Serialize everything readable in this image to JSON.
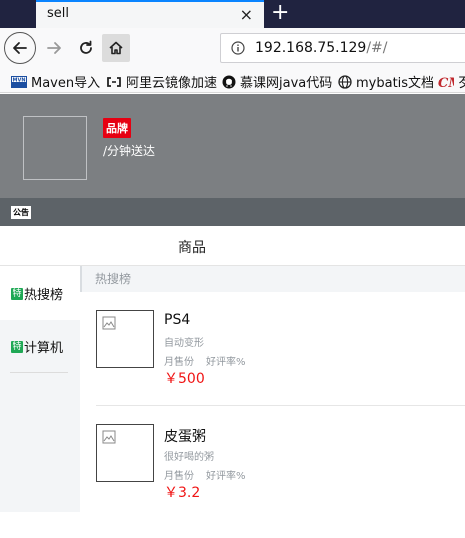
{
  "browser": {
    "tab_title": "sell",
    "close_glyph": "×",
    "newtab_glyph": "+",
    "url_host": "192.168.75.129",
    "url_path": "/#/",
    "bookmarks": [
      {
        "label": "Maven导入",
        "icon": "maven-icon"
      },
      {
        "label": "阿里云镜像加速",
        "icon": "aliyun-icon"
      },
      {
        "label": "慕课网java代码",
        "icon": "github-icon"
      },
      {
        "label": "mybatis文档",
        "icon": "globe-icon"
      },
      {
        "label": "歹",
        "icon": "cm-icon"
      }
    ],
    "accent_color": "#0a84ff"
  },
  "header": {
    "brand_badge": "品牌",
    "delivery": "/分钟送达",
    "notice_badge": "公告"
  },
  "tabs": {
    "goods": "商品"
  },
  "menu": {
    "items": [
      {
        "tag": "特",
        "label": "热搜榜"
      },
      {
        "tag": "特",
        "label": "计算机"
      }
    ]
  },
  "list": {
    "section_title": "热搜榜",
    "foods": [
      {
        "name": "PS4",
        "description": "自动变形",
        "monthly_sales": "月售份",
        "rating": "好评率%",
        "price": "￥500"
      },
      {
        "name": "皮蛋粥",
        "description": "很好喝的粥",
        "monthly_sales": "月售份",
        "rating": "好评率%",
        "price": "￥3.2"
      }
    ]
  }
}
